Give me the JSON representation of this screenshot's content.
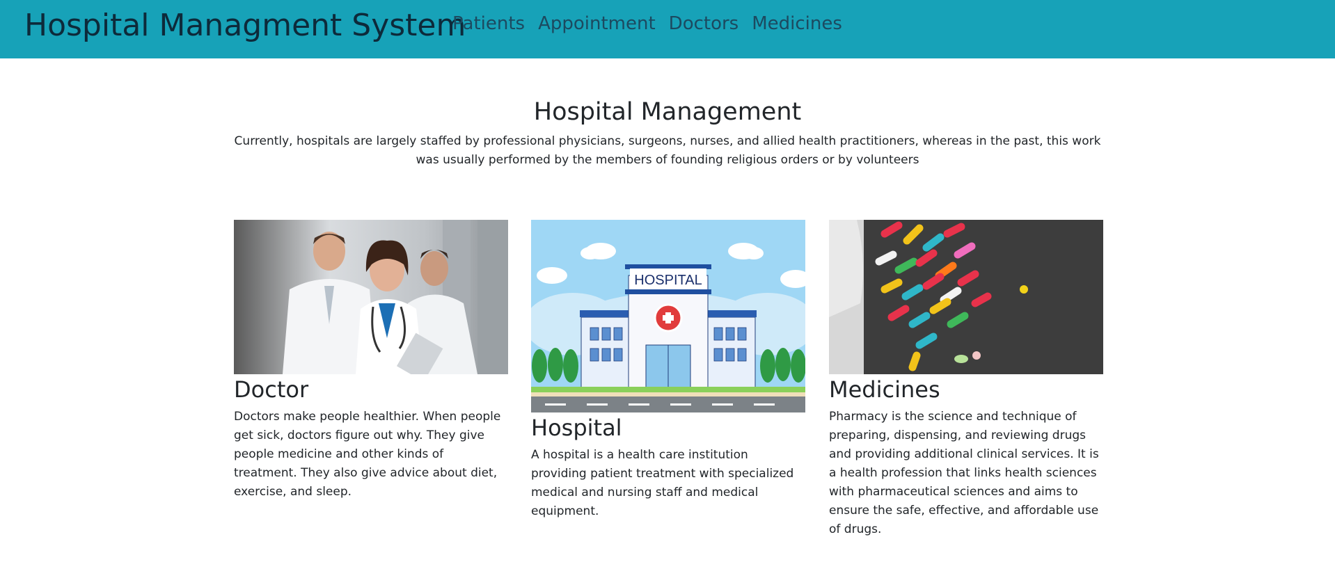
{
  "navbar": {
    "brand": "Hospital Managment System",
    "links": [
      "Patients",
      "Appointment",
      "Doctors",
      "Medicines"
    ]
  },
  "hero": {
    "title": "Hospital Management",
    "text": "Currently, hospitals are largely staffed by professional physicians, surgeons, nurses, and allied health practitioners, whereas in the past, this work was usually performed by the members of founding religious orders or by volunteers"
  },
  "cards": [
    {
      "title": "Doctor",
      "text": "Doctors make people healthier. When people get sick, doctors figure out why. They give people medicine and other kinds of treatment. They also give advice about diet, exercise, and sleep."
    },
    {
      "title": "Hospital",
      "text": "A hospital is a health care institution providing patient treatment with specialized medical and nursing staff and medical equipment.",
      "image_sign": "HOSPITAL"
    },
    {
      "title": "Medicines",
      "text": "Pharmacy is the science and technique of preparing, dispensing, and reviewing drugs and providing additional clinical services. It is a health profession that links health sciences with pharmaceutical sciences and aims to ensure the safe, effective, and affordable use of drugs."
    }
  ],
  "colors": {
    "navbar": "#17a2b8",
    "brand": "#0d2a3a",
    "nav_link": "#1c4a60",
    "text": "#212529"
  }
}
